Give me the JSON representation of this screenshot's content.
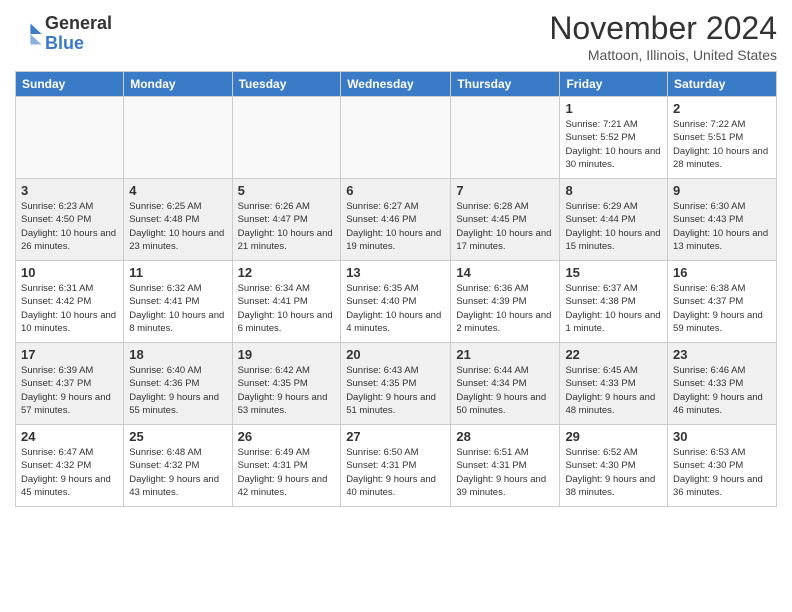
{
  "header": {
    "title": "November 2024",
    "location": "Mattoon, Illinois, United States",
    "logo_general": "General",
    "logo_blue": "Blue"
  },
  "days_of_week": [
    "Sunday",
    "Monday",
    "Tuesday",
    "Wednesday",
    "Thursday",
    "Friday",
    "Saturday"
  ],
  "weeks": [
    {
      "shaded": false,
      "days": [
        {
          "num": "",
          "info": ""
        },
        {
          "num": "",
          "info": ""
        },
        {
          "num": "",
          "info": ""
        },
        {
          "num": "",
          "info": ""
        },
        {
          "num": "",
          "info": ""
        },
        {
          "num": "1",
          "info": "Sunrise: 7:21 AM\nSunset: 5:52 PM\nDaylight: 10 hours\nand 30 minutes."
        },
        {
          "num": "2",
          "info": "Sunrise: 7:22 AM\nSunset: 5:51 PM\nDaylight: 10 hours\nand 28 minutes."
        }
      ]
    },
    {
      "shaded": true,
      "days": [
        {
          "num": "3",
          "info": "Sunrise: 6:23 AM\nSunset: 4:50 PM\nDaylight: 10 hours\nand 26 minutes."
        },
        {
          "num": "4",
          "info": "Sunrise: 6:25 AM\nSunset: 4:48 PM\nDaylight: 10 hours\nand 23 minutes."
        },
        {
          "num": "5",
          "info": "Sunrise: 6:26 AM\nSunset: 4:47 PM\nDaylight: 10 hours\nand 21 minutes."
        },
        {
          "num": "6",
          "info": "Sunrise: 6:27 AM\nSunset: 4:46 PM\nDaylight: 10 hours\nand 19 minutes."
        },
        {
          "num": "7",
          "info": "Sunrise: 6:28 AM\nSunset: 4:45 PM\nDaylight: 10 hours\nand 17 minutes."
        },
        {
          "num": "8",
          "info": "Sunrise: 6:29 AM\nSunset: 4:44 PM\nDaylight: 10 hours\nand 15 minutes."
        },
        {
          "num": "9",
          "info": "Sunrise: 6:30 AM\nSunset: 4:43 PM\nDaylight: 10 hours\nand 13 minutes."
        }
      ]
    },
    {
      "shaded": false,
      "days": [
        {
          "num": "10",
          "info": "Sunrise: 6:31 AM\nSunset: 4:42 PM\nDaylight: 10 hours\nand 10 minutes."
        },
        {
          "num": "11",
          "info": "Sunrise: 6:32 AM\nSunset: 4:41 PM\nDaylight: 10 hours\nand 8 minutes."
        },
        {
          "num": "12",
          "info": "Sunrise: 6:34 AM\nSunset: 4:41 PM\nDaylight: 10 hours\nand 6 minutes."
        },
        {
          "num": "13",
          "info": "Sunrise: 6:35 AM\nSunset: 4:40 PM\nDaylight: 10 hours\nand 4 minutes."
        },
        {
          "num": "14",
          "info": "Sunrise: 6:36 AM\nSunset: 4:39 PM\nDaylight: 10 hours\nand 2 minutes."
        },
        {
          "num": "15",
          "info": "Sunrise: 6:37 AM\nSunset: 4:38 PM\nDaylight: 10 hours\nand 1 minute."
        },
        {
          "num": "16",
          "info": "Sunrise: 6:38 AM\nSunset: 4:37 PM\nDaylight: 9 hours\nand 59 minutes."
        }
      ]
    },
    {
      "shaded": true,
      "days": [
        {
          "num": "17",
          "info": "Sunrise: 6:39 AM\nSunset: 4:37 PM\nDaylight: 9 hours\nand 57 minutes."
        },
        {
          "num": "18",
          "info": "Sunrise: 6:40 AM\nSunset: 4:36 PM\nDaylight: 9 hours\nand 55 minutes."
        },
        {
          "num": "19",
          "info": "Sunrise: 6:42 AM\nSunset: 4:35 PM\nDaylight: 9 hours\nand 53 minutes."
        },
        {
          "num": "20",
          "info": "Sunrise: 6:43 AM\nSunset: 4:35 PM\nDaylight: 9 hours\nand 51 minutes."
        },
        {
          "num": "21",
          "info": "Sunrise: 6:44 AM\nSunset: 4:34 PM\nDaylight: 9 hours\nand 50 minutes."
        },
        {
          "num": "22",
          "info": "Sunrise: 6:45 AM\nSunset: 4:33 PM\nDaylight: 9 hours\nand 48 minutes."
        },
        {
          "num": "23",
          "info": "Sunrise: 6:46 AM\nSunset: 4:33 PM\nDaylight: 9 hours\nand 46 minutes."
        }
      ]
    },
    {
      "shaded": false,
      "days": [
        {
          "num": "24",
          "info": "Sunrise: 6:47 AM\nSunset: 4:32 PM\nDaylight: 9 hours\nand 45 minutes."
        },
        {
          "num": "25",
          "info": "Sunrise: 6:48 AM\nSunset: 4:32 PM\nDaylight: 9 hours\nand 43 minutes."
        },
        {
          "num": "26",
          "info": "Sunrise: 6:49 AM\nSunset: 4:31 PM\nDaylight: 9 hours\nand 42 minutes."
        },
        {
          "num": "27",
          "info": "Sunrise: 6:50 AM\nSunset: 4:31 PM\nDaylight: 9 hours\nand 40 minutes."
        },
        {
          "num": "28",
          "info": "Sunrise: 6:51 AM\nSunset: 4:31 PM\nDaylight: 9 hours\nand 39 minutes."
        },
        {
          "num": "29",
          "info": "Sunrise: 6:52 AM\nSunset: 4:30 PM\nDaylight: 9 hours\nand 38 minutes."
        },
        {
          "num": "30",
          "info": "Sunrise: 6:53 AM\nSunset: 4:30 PM\nDaylight: 9 hours\nand 36 minutes."
        }
      ]
    }
  ]
}
